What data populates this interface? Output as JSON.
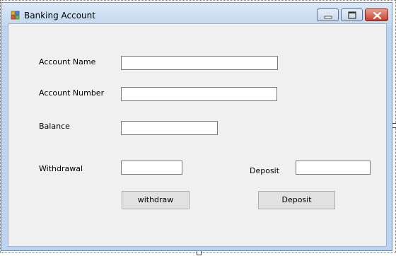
{
  "window": {
    "title": "Banking Account"
  },
  "form": {
    "account_name_label": "Account Name",
    "account_number_label": "Account Number",
    "balance_label": "Balance",
    "withdrawal_label": "Withdrawal",
    "deposit_label": "Deposit",
    "account_name_value": "",
    "account_number_value": "",
    "balance_value": "",
    "withdrawal_value": "",
    "deposit_value": "",
    "withdraw_button": "withdraw",
    "deposit_button": "Deposit"
  },
  "icons": {
    "app": "app-icon",
    "minimize": "minimize-icon",
    "maximize": "maximize-icon",
    "close": "close-icon"
  }
}
